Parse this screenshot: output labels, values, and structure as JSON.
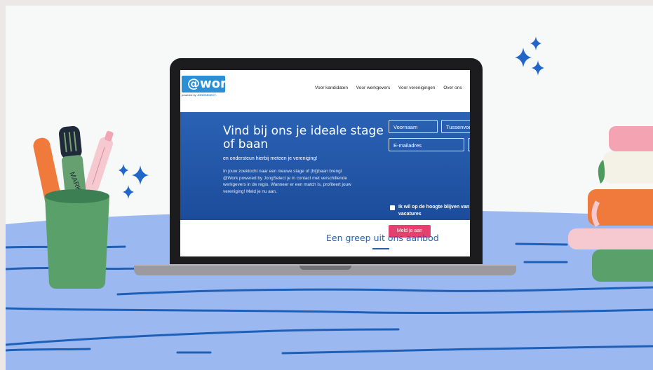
{
  "site": {
    "logo": "@work",
    "logo_sub_prefix": "powered by",
    "logo_sub_brand": "JONGSELECT.",
    "nav": [
      "Voor kandidaten",
      "Voor werkgevers",
      "Voor verenigingen",
      "Over ons"
    ],
    "hero": {
      "title": "Vind bij ons je ideale stage of baan",
      "subtitle": "en ondersteun hierbij meteen je vereniging!",
      "text": "In jouw zoektocht naar een nieuwe stage of (bij)baan brengt @Work powered by JongSelect je in contact met verschillende werkgevers in de regio. Wanneer er een match is, profiteert jouw vereniging! Meld je nu aan."
    },
    "form": {
      "first_name": "Voornaam",
      "middle_name": "Tussenvoegsel",
      "email": "E-mailadres",
      "extra": "M",
      "checkbox_label": "Ik wil op de hoogte blijven van vacatures",
      "submit": "Meld je aan"
    },
    "section_title": "Een greep uit ons aanbod"
  },
  "decor": {
    "marker_text": "MARK"
  },
  "colors": {
    "hero_blue": "#2b62b4",
    "cta_pink": "#e6416e",
    "logo_blue": "#2c8fd6",
    "floor_blue": "#9cb8f0",
    "sparkle": "#2366c9"
  }
}
